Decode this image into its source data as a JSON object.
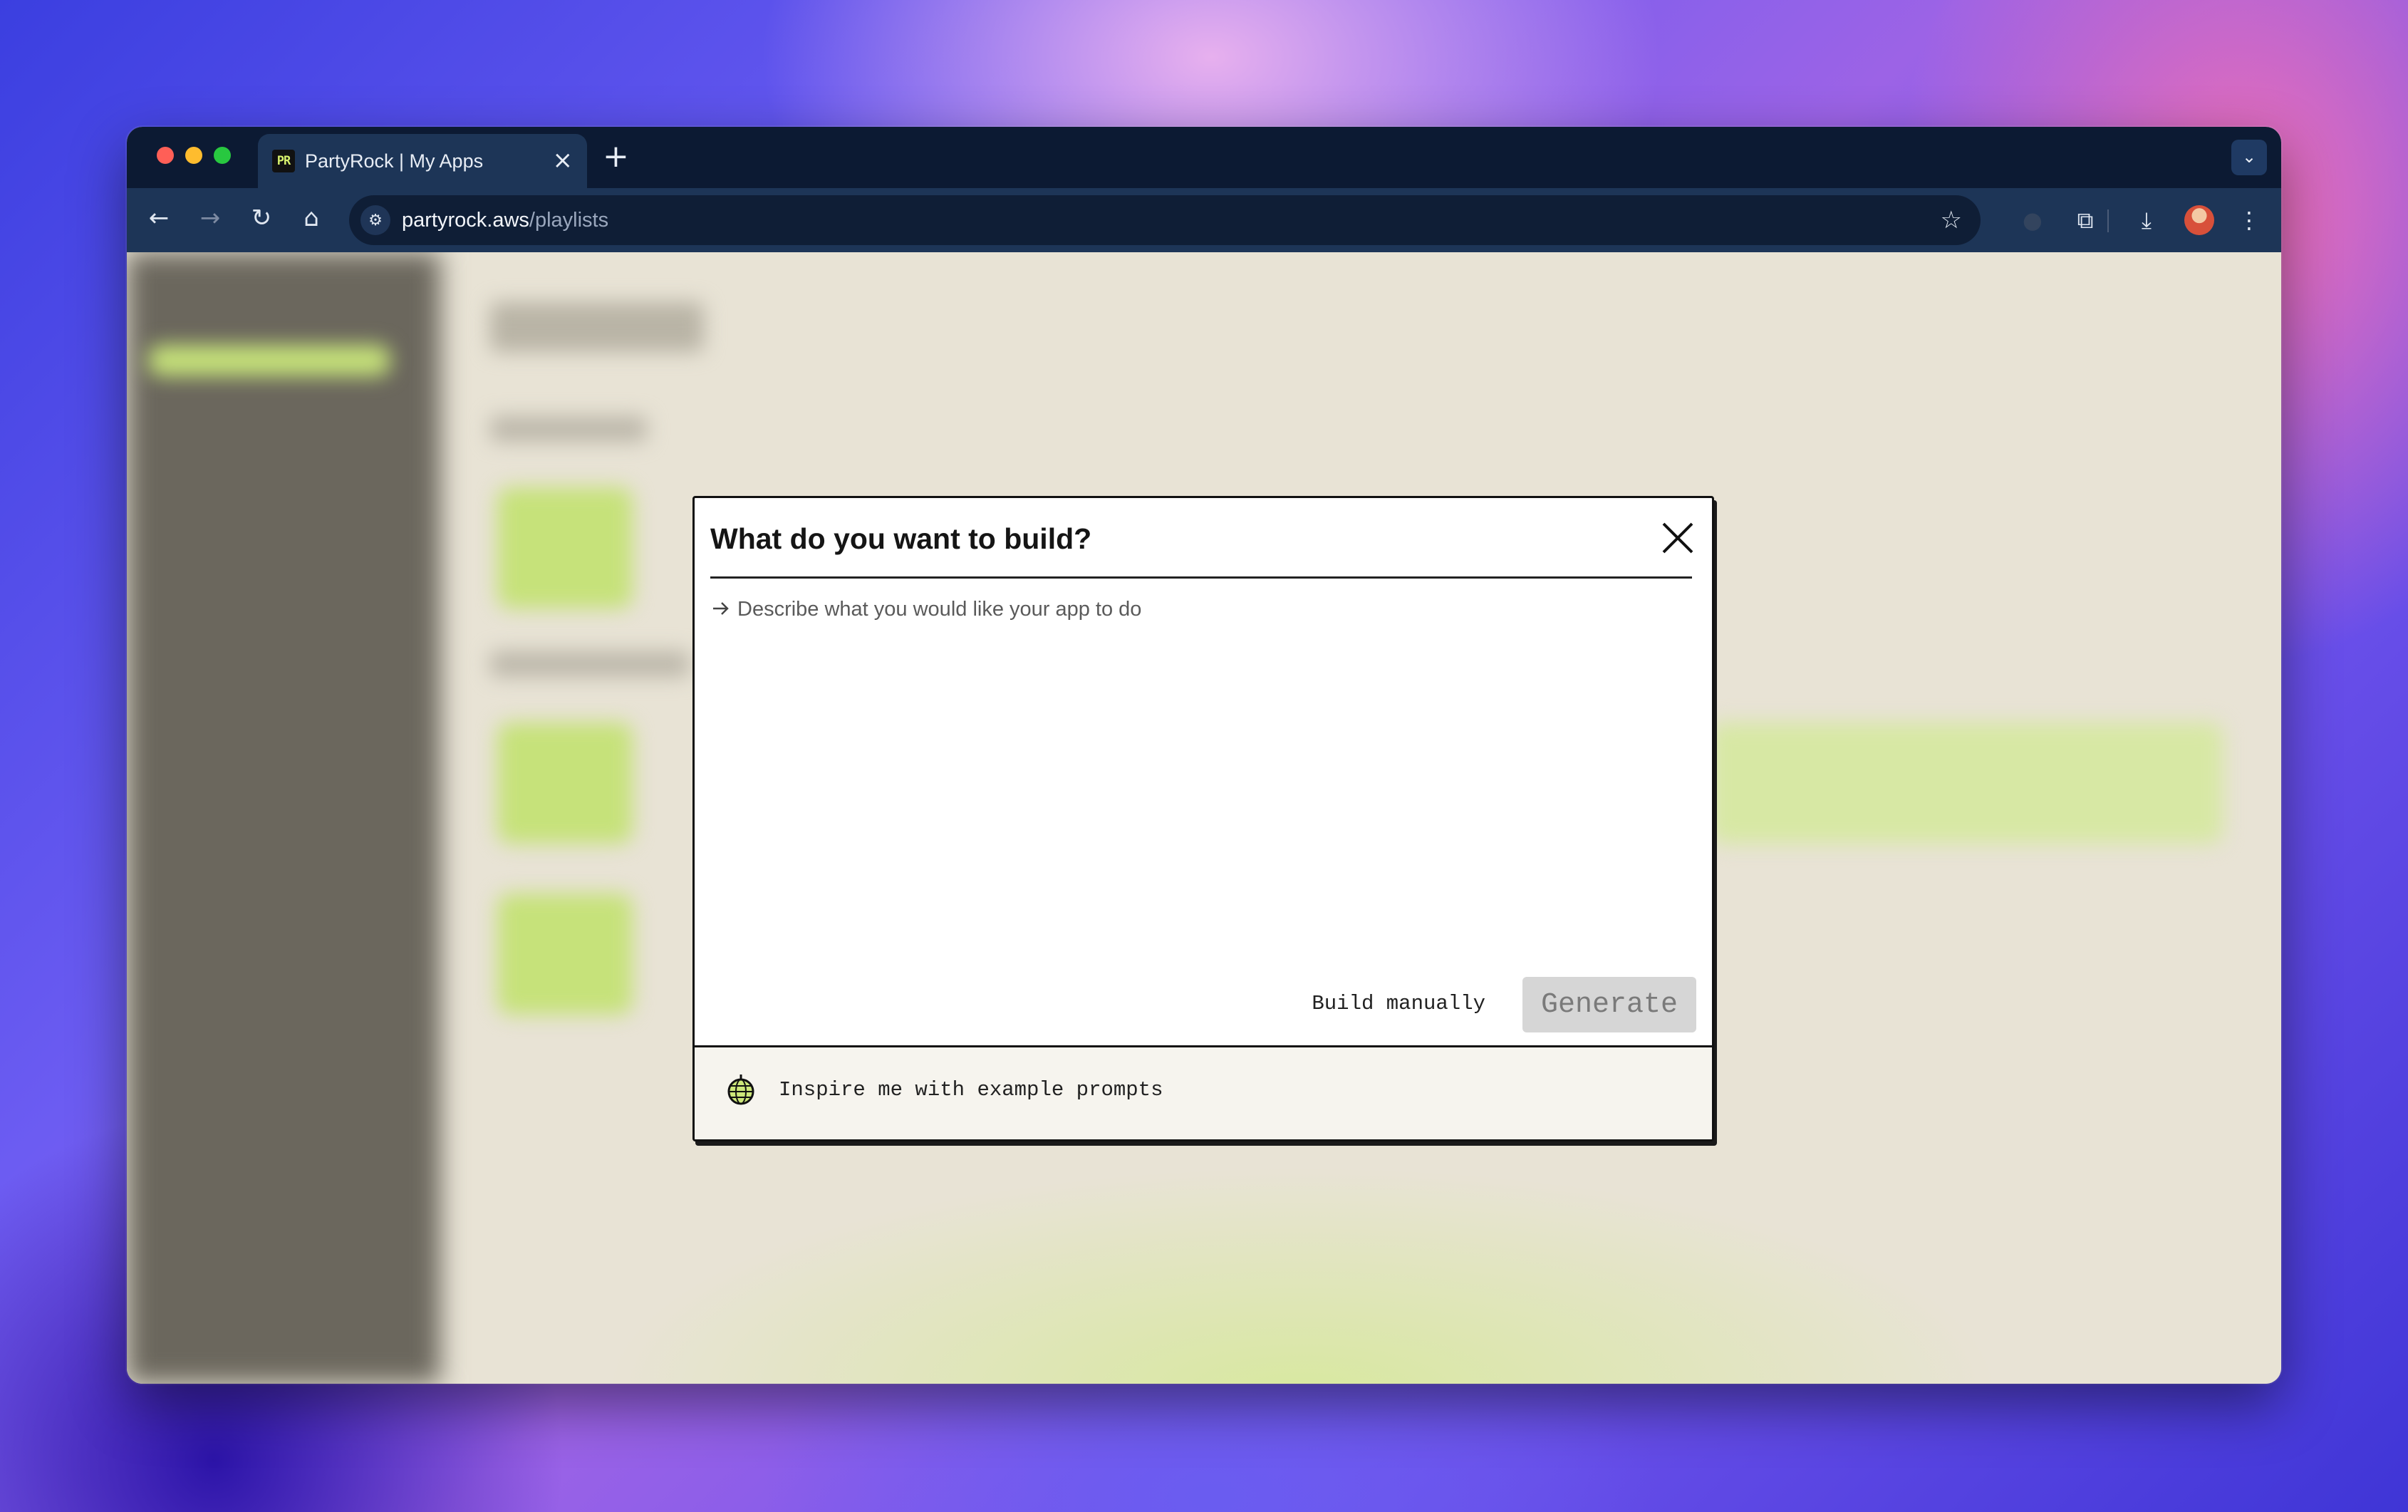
{
  "browser": {
    "tab_title": "PartyRock | My Apps",
    "favicon_text": "PR",
    "tab_close": "×",
    "new_tab": "+",
    "url_host": "partyrock.aws",
    "url_path": "/playlists"
  },
  "modal": {
    "title": "What do you want to build?",
    "prompt_placeholder": "Describe what you would like your app to do",
    "build_manually_label": "Build manually",
    "generate_label": "Generate",
    "inspire_label": "Inspire me with example prompts"
  },
  "colors": {
    "tabbar": "#0c1a33",
    "toolbar": "#1d3557",
    "page_bg": "#e8e3d5",
    "sidebar_bg": "#6b675d",
    "accent_green": "#c6e27a",
    "generate_disabled": "#d6d6d6"
  },
  "icons": [
    "back-icon",
    "forward-icon",
    "reload-icon",
    "home-icon",
    "site-settings-icon",
    "bookmark-star-icon",
    "extensions-icon",
    "download-icon",
    "more-menu-icon",
    "close-icon",
    "arrow-right-icon",
    "disco-ball-icon"
  ]
}
